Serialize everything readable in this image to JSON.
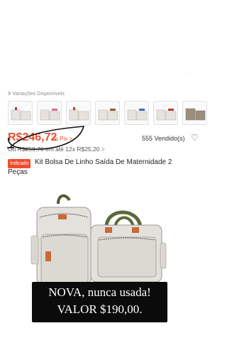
{
  "gallery": {
    "corner_mark": "· ·"
  },
  "variations": {
    "label": "9 Variações Disponíveis",
    "thumbnails": [
      "variation-1",
      "variation-2",
      "variation-3",
      "variation-4",
      "variation-5",
      "variation-6",
      "variation-7",
      "variation-8"
    ]
  },
  "price": {
    "current": "R$246,72",
    "suffix": "no Pix >",
    "sold": "555 Vendido(s)",
    "installments": "Ou R$259,70 em até 12x R$25,20",
    "installments_chevron": ">"
  },
  "product": {
    "badge": "Indicado",
    "title_line1": "Kit Bolsa De Linho Saída De Maternidade 2",
    "title_line2": "Peças"
  },
  "overlay": {
    "line1": "NOVA, nunca usada!",
    "line2": "VALOR  $190,00."
  },
  "colors": {
    "accent": "#ee4d2d",
    "bag_body": "#e4e1dc",
    "bag_strap": "#5a6b3a",
    "tag": "#c86a34"
  }
}
